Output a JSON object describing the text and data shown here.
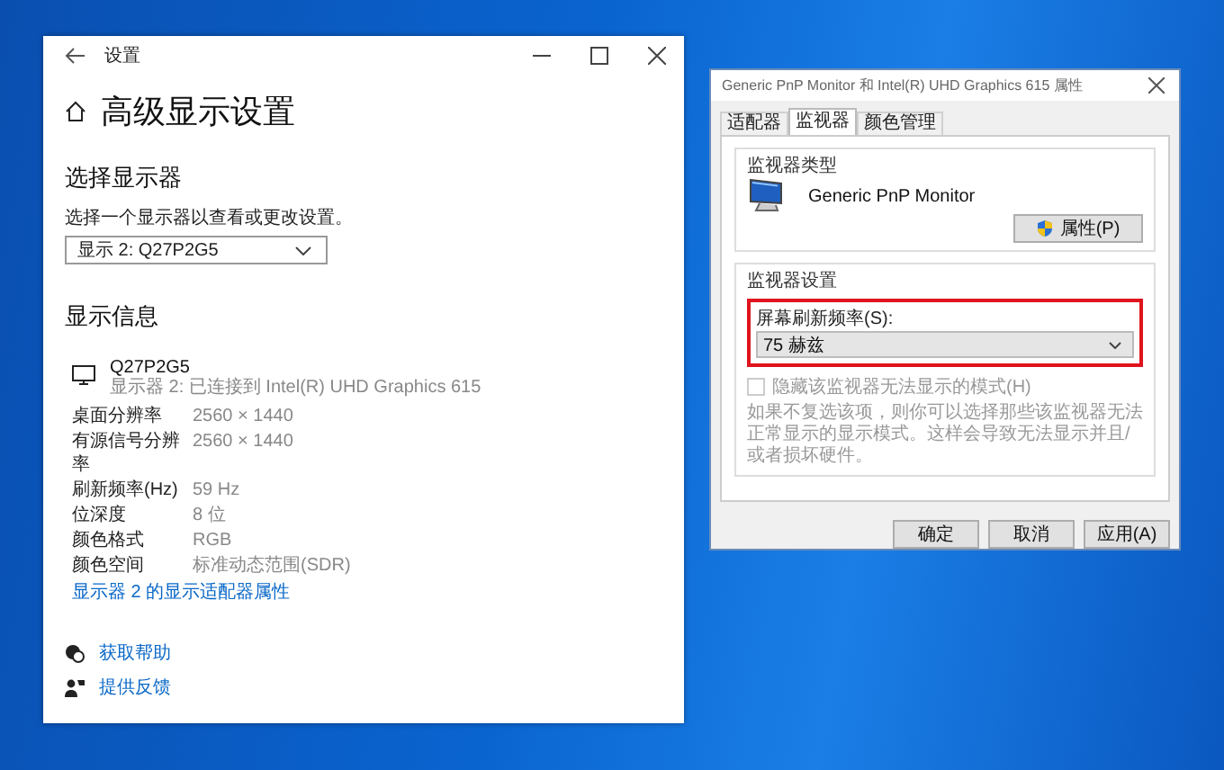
{
  "settings_window": {
    "title": "设置",
    "page_title": "高级显示设置",
    "select_display": {
      "heading": "选择显示器",
      "caption": "选择一个显示器以查看或更改设置。",
      "dropdown_value": "显示 2: Q27P2G5"
    },
    "display_info": {
      "heading": "显示信息",
      "monitor_name": "Q27P2G5",
      "monitor_connection": "显示器 2: 已连接到 Intel(R) UHD Graphics 615",
      "rows": [
        {
          "label": "桌面分辨率",
          "value": "2560 × 1440"
        },
        {
          "label": "有源信号分辨率",
          "value": "2560 × 1440"
        },
        {
          "label": "刷新频率(Hz)",
          "value": "59 Hz"
        },
        {
          "label": "位深度",
          "value": "8 位"
        },
        {
          "label": "颜色格式",
          "value": "RGB"
        },
        {
          "label": "颜色空间",
          "value": "标准动态范围(SDR)"
        }
      ],
      "adapter_link": "显示器 2 的显示适配器属性"
    },
    "help_links": [
      {
        "kind": "help",
        "label": "获取帮助"
      },
      {
        "kind": "feedback",
        "label": "提供反馈"
      }
    ]
  },
  "dialog": {
    "title": "Generic PnP Monitor 和 Intel(R) UHD Graphics 615 属性",
    "tabs": [
      {
        "label": "适配器",
        "selected": false
      },
      {
        "label": "监视器",
        "selected": true
      },
      {
        "label": "颜色管理",
        "selected": false
      }
    ],
    "monitor_type": {
      "group_title": "监视器类型",
      "monitor_name": "Generic PnP Monitor",
      "properties_button": "属性(P)"
    },
    "monitor_settings": {
      "group_title": "监视器设置",
      "refresh_label": "屏幕刷新频率(S):",
      "refresh_value": "75 赫兹",
      "highlighted": true,
      "hide_modes": {
        "label": "隐藏该监视器无法显示的模式(H)",
        "checked": false,
        "disabled": true
      },
      "description": "如果不复选该项，则你可以选择那些该监视器无法正常显示的显示模式。这样会导致无法显示并且/或者损坏硬件。"
    },
    "buttons": [
      "确定",
      "取消",
      "应用(A)"
    ]
  }
}
